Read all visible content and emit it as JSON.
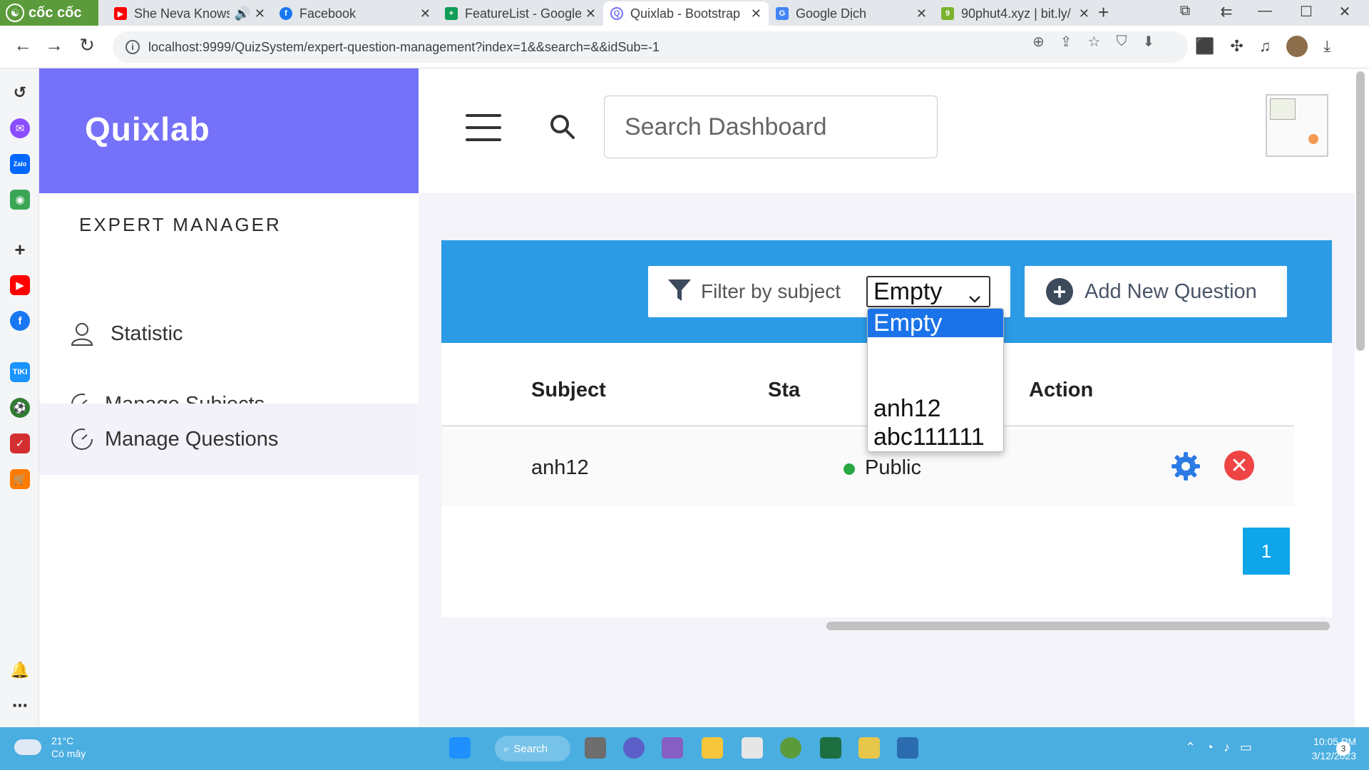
{
  "browser": {
    "brand": "cốc cốc",
    "tabs": [
      {
        "title": "She Neva Knows",
        "favicon_color": "#ff0000"
      },
      {
        "title": "Facebook",
        "favicon_color": "#1877f2"
      },
      {
        "title": "FeatureList - Google",
        "favicon_color": "#0f9d58"
      },
      {
        "title": "Quixlab - Bootstrap",
        "favicon_color": "#7571f9"
      },
      {
        "title": "Google Dịch",
        "favicon_color": "#4285f4"
      },
      {
        "title": "90phut4.xyz | bit.ly/",
        "favicon_color": "#7bb32e"
      }
    ],
    "url": "localhost:9999/QuizSystem/expert-question-management?index=1&&search=&&idSub=-1"
  },
  "app": {
    "logo": "Quixlab",
    "sidebar_heading": "EXPERT MANAGER",
    "menu": [
      {
        "label": "Statistic",
        "icon": "user-icon"
      },
      {
        "label": "Manage Subjects",
        "icon": "speedometer-icon"
      },
      {
        "label": "Manage Questions",
        "icon": "speedometer-icon"
      }
    ],
    "search": {
      "placeholder": "Search Dashboard"
    },
    "filter": {
      "label": "Filter by subject",
      "selected": "Empty"
    },
    "dropdown_options": [
      "Empty",
      "",
      "anh12",
      "abc111111"
    ],
    "add_button": "Add New Question",
    "table": {
      "headers": {
        "subject": "Subject",
        "status": "Sta",
        "action": "Action"
      },
      "rows": [
        {
          "subject": "anh12",
          "status": "Public"
        }
      ]
    },
    "pagination": {
      "current": "1"
    }
  },
  "taskbar": {
    "temperature": "21°C",
    "weather": "Có mây",
    "search": "Search",
    "time": "10:05 PM",
    "date": "3/12/2023",
    "notifications": "3"
  }
}
